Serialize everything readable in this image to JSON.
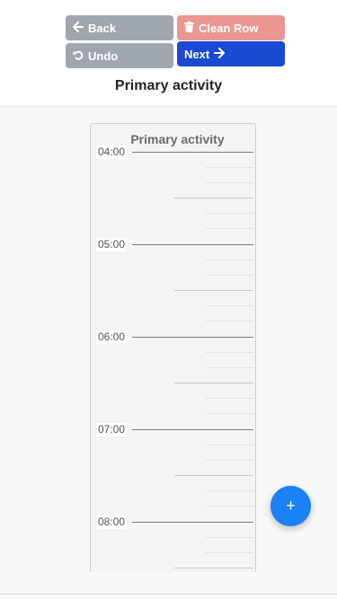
{
  "toolbar": {
    "back_label": "Back",
    "clean_row_label": "Clean Row",
    "undo_label": "Undo",
    "next_label": "Next"
  },
  "page_title": "Primary activity",
  "timeline": {
    "column_title": "Primary activity",
    "hours": [
      "04:00",
      "05:00",
      "06:00",
      "07:00",
      "08:00"
    ]
  },
  "fab": {
    "label": "+"
  },
  "colors": {
    "back": "#a0a6ae",
    "clean_row": "#ec9691",
    "next": "#1a49d4",
    "fab": "#1a82f5"
  },
  "icons": {
    "back": "arrow-left-icon",
    "clean_row": "trash-icon",
    "undo": "undo-icon",
    "next": "arrow-right-icon"
  }
}
